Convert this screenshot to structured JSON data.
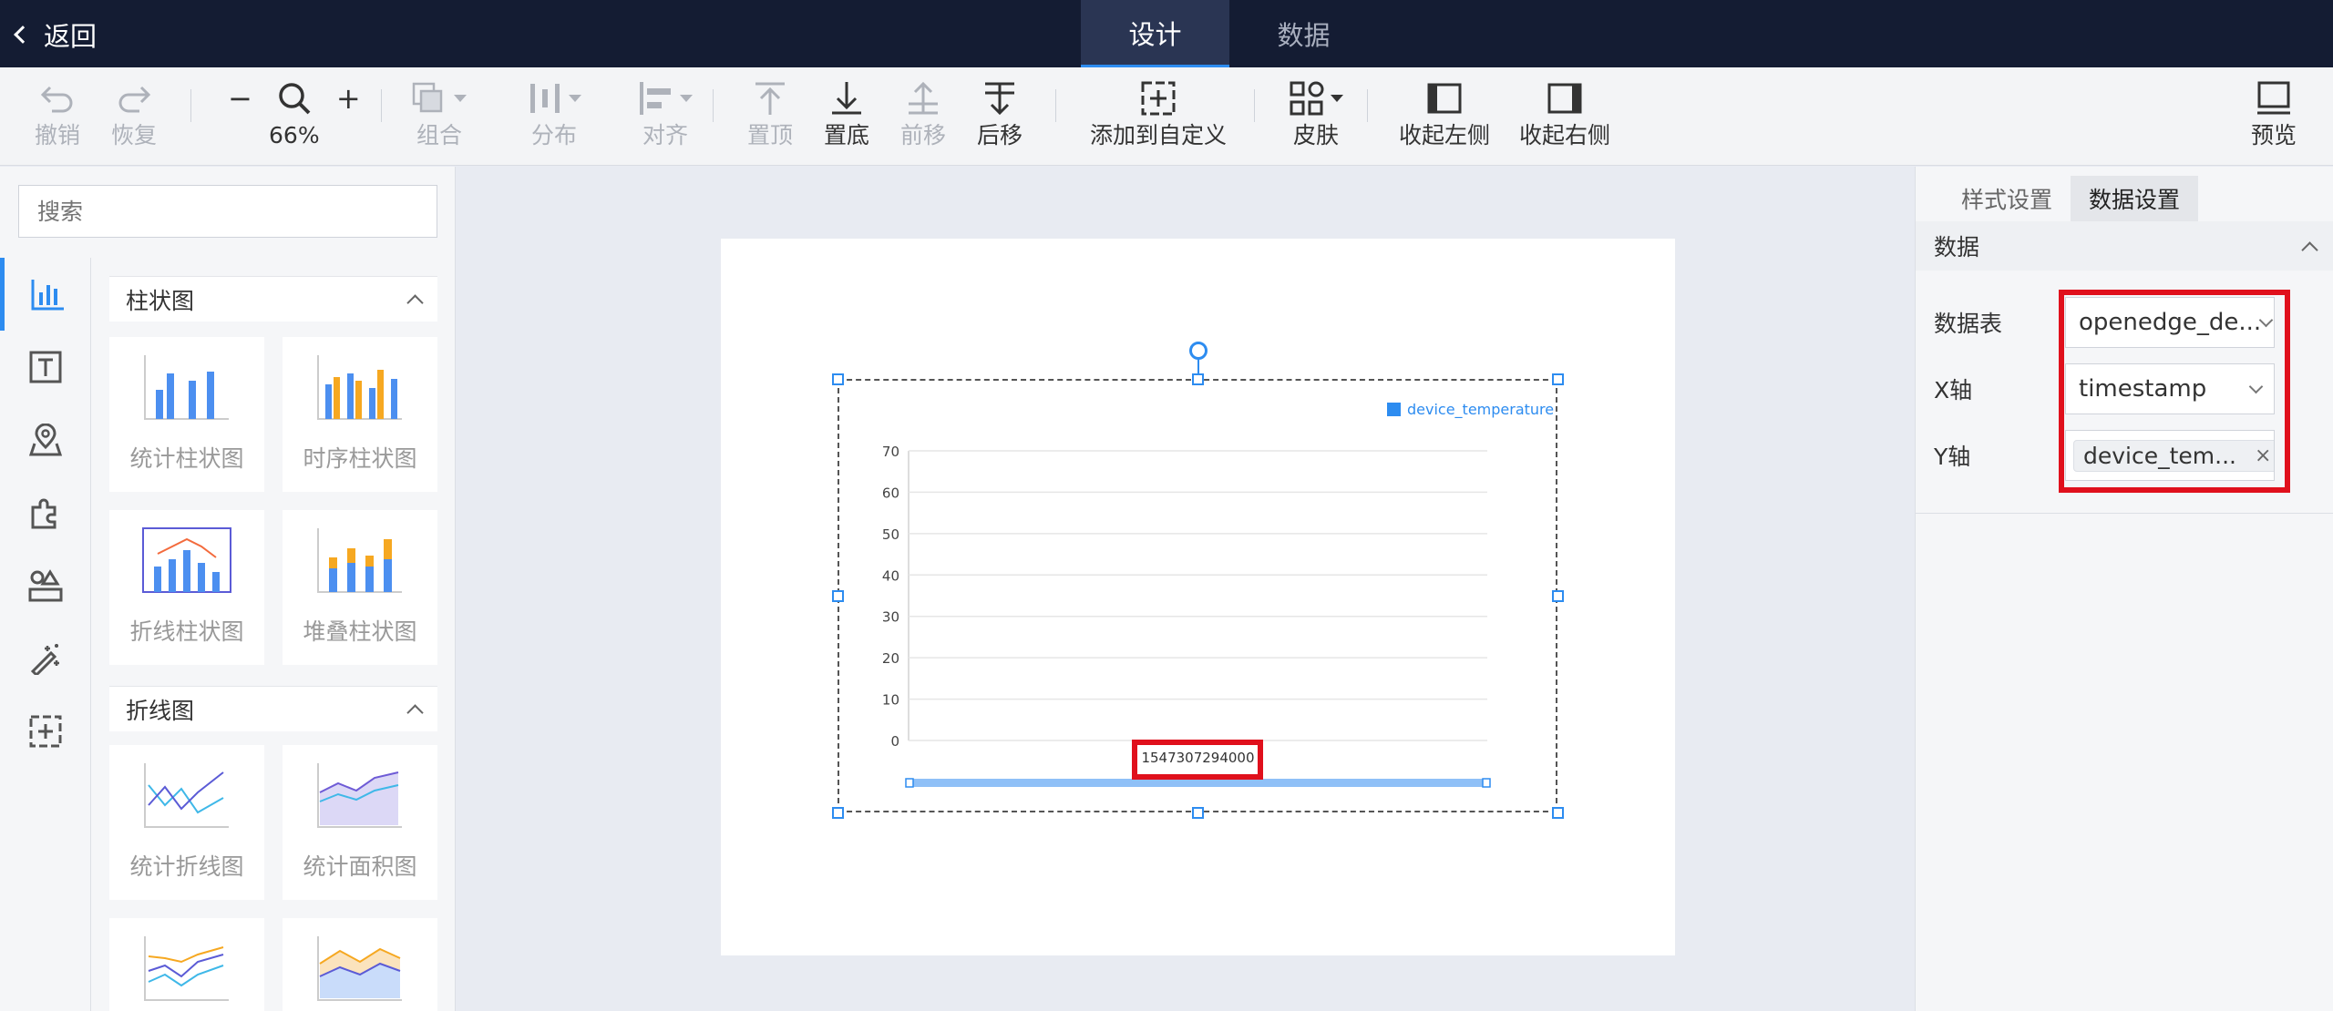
{
  "header": {
    "back_label": "返回",
    "tabs": [
      {
        "label": "设计"
      },
      {
        "label": "数据"
      }
    ]
  },
  "toolbar": {
    "undo": "撤销",
    "redo": "恢复",
    "zoom": "66%",
    "group": "组合",
    "distribute": "分布",
    "align": "对齐",
    "to_top": "置顶",
    "to_bottom": "置底",
    "forward": "前移",
    "backward": "后移",
    "add_custom": "添加到自定义",
    "skin": "皮肤",
    "collapse_left": "收起左侧",
    "collapse_right": "收起右侧",
    "preview": "预览"
  },
  "left_panel": {
    "search_placeholder": "搜索",
    "sections": [
      {
        "title": "柱状图",
        "items": [
          "统计柱状图",
          "时序柱状图",
          "折线柱状图",
          "堆叠柱状图"
        ]
      },
      {
        "title": "折线图",
        "items": [
          "统计折线图",
          "统计面积图"
        ]
      }
    ]
  },
  "right_panel": {
    "tabs": [
      "样式设置",
      "数据设置"
    ],
    "section_title": "数据",
    "fields": {
      "table": {
        "label": "数据表",
        "value": "openedge_de..."
      },
      "x_axis": {
        "label": "X轴",
        "value": "timestamp"
      },
      "y_axis": {
        "label": "Y轴",
        "tag": "device_tem...",
        "tag_close": "×"
      }
    }
  },
  "chart_data": {
    "type": "bar",
    "categories": [
      "1547307294000"
    ],
    "series": [
      {
        "name": "device_temperature",
        "values": [
          0
        ]
      }
    ],
    "ylim": [
      0,
      70
    ],
    "yticks": [
      0,
      10,
      20,
      30,
      40,
      50,
      60,
      70
    ],
    "legend": "top-right",
    "grid": true,
    "series_color": "#2d8cf0"
  },
  "colors": {
    "accent": "#2d8cf0",
    "highlight": "#e0101c",
    "topbar": "#141c33"
  }
}
